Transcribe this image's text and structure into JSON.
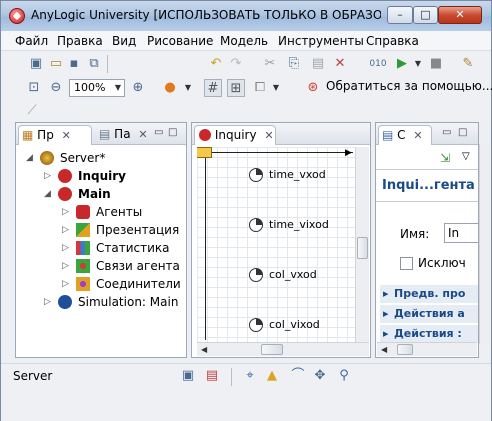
{
  "window": {
    "title": "AnyLogic University [ИСПОЛЬЗОВАТЬ ТОЛЬКО В ОБРАЗОВАТЕ...",
    "min_glyph": "–",
    "max_glyph": "□",
    "close_glyph": "✕"
  },
  "menu": [
    "Файл",
    "Правка",
    "Вид",
    "Рисование",
    "Модель",
    "Инструменты",
    "Справка"
  ],
  "toolbar": {
    "zoom_value": "100%",
    "help_label": "Обратиться за помощью..."
  },
  "left_panel": {
    "tabs": [
      {
        "label": "Пр",
        "close": "✕"
      },
      {
        "label": "Па",
        "close": "✕"
      }
    ],
    "tree": [
      {
        "label": "Server*",
        "bold": false
      },
      {
        "label": "Inquiry",
        "bold": true
      },
      {
        "label": "Main",
        "bold": true
      },
      {
        "label": "Агенты",
        "bold": false
      },
      {
        "label": "Презентация",
        "bold": false
      },
      {
        "label": "Статистика",
        "bold": false
      },
      {
        "label": "Связи агента",
        "bold": false
      },
      {
        "label": "Соединители",
        "bold": false
      },
      {
        "label": "Simulation: Main",
        "bold": false
      }
    ]
  },
  "editor": {
    "tab_label": "Inquiry",
    "tab_close": "✕",
    "elements": [
      "time_vxod",
      "time_vixod",
      "col_vxod",
      "col_vixod"
    ]
  },
  "props": {
    "tab_label": "С",
    "tab_close": "✕",
    "title": "Inqui...гента",
    "name_label": "Имя:",
    "name_value": "In",
    "exclude_label": "Исключ",
    "sections": [
      "Предв. про",
      "Действия а",
      "Действия :"
    ]
  },
  "status": {
    "text": "Server"
  }
}
